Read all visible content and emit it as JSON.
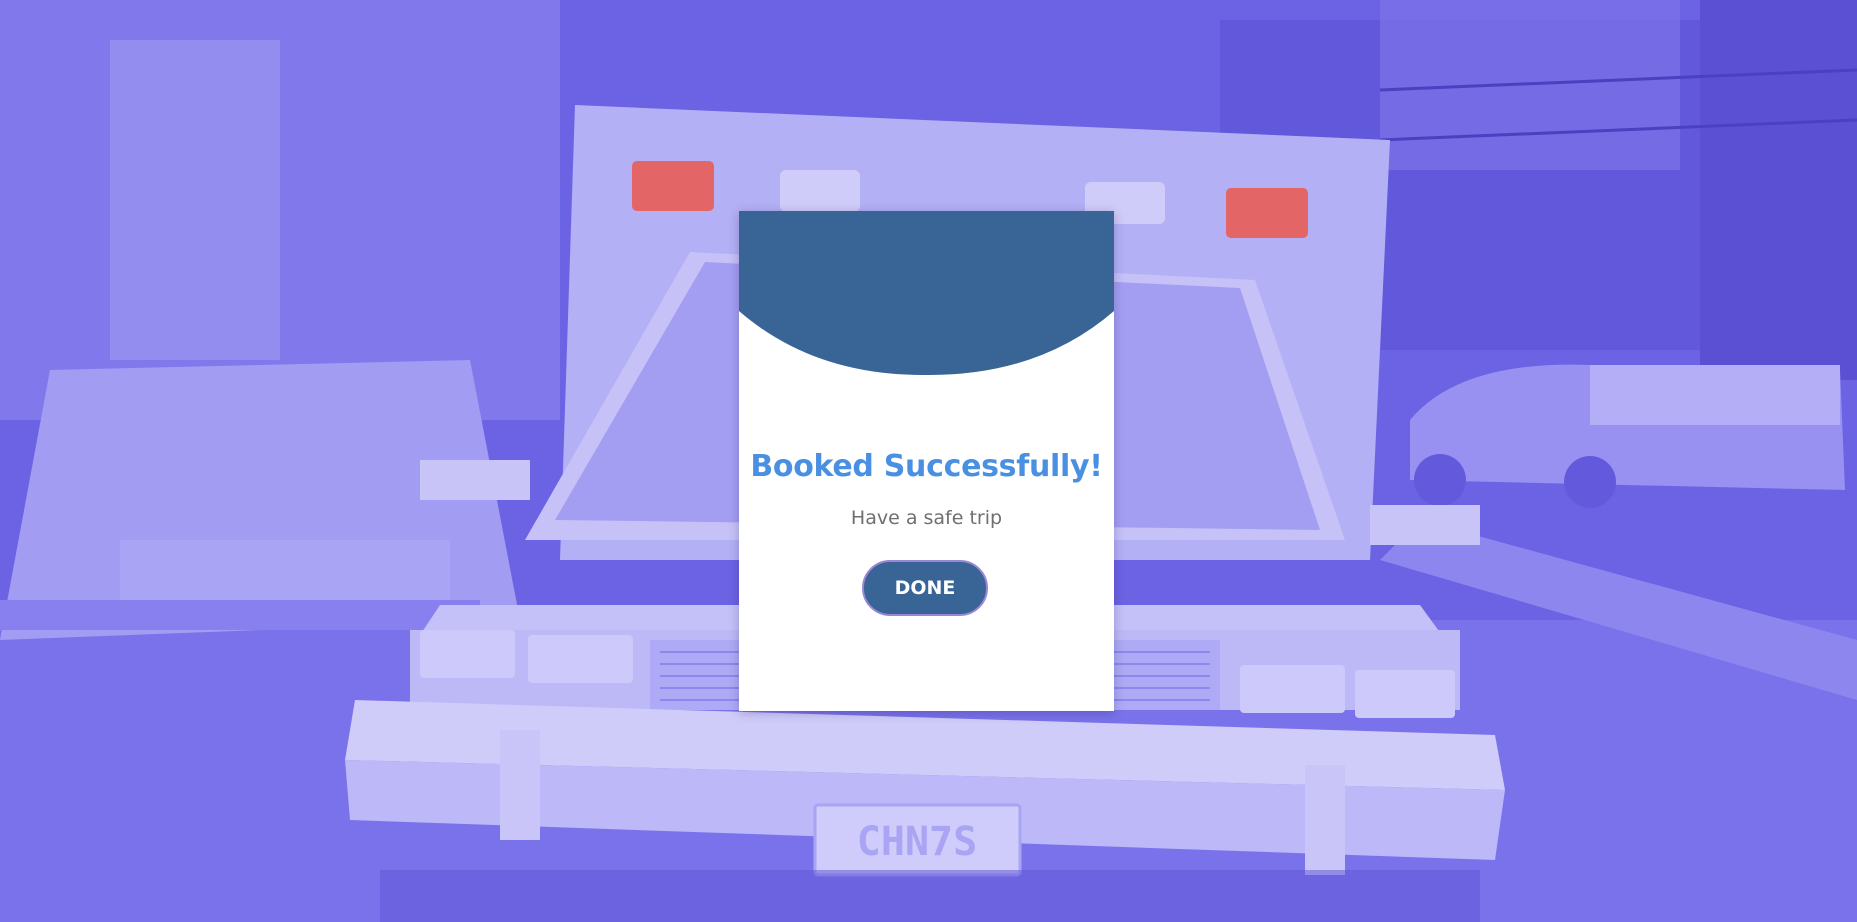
{
  "modal": {
    "title": "Booked Successfully!",
    "subtitle": "Have a safe trip",
    "done_label": "DONE"
  },
  "background": {
    "plate_text": "CHN7S"
  },
  "colors": {
    "header": "#396496",
    "title": "#4a90e2",
    "subtitle": "#6f6f6f",
    "button": "#396496",
    "button_border": "#9a88d6",
    "backdrop": "#6f66e6"
  }
}
